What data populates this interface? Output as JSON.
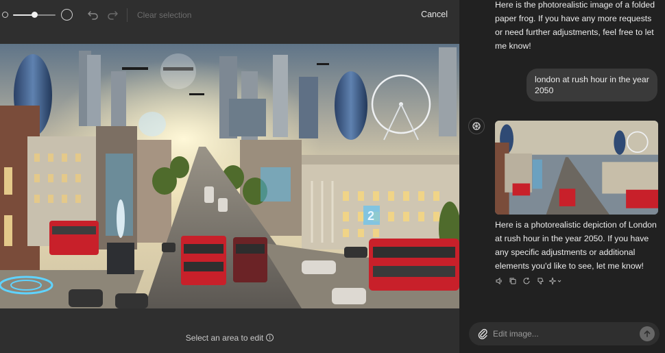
{
  "toolbar": {
    "clear_selection_label": "Clear selection",
    "cancel_label": "Cancel",
    "brush_size_percent": 50,
    "undo_icon": "undo-icon",
    "redo_icon": "redo-icon"
  },
  "editor": {
    "hint": "Select an area to edit",
    "hint_icon": "info-icon",
    "image_subject": "london-2050-rush-hour",
    "image_sign_number": "2"
  },
  "chat": {
    "assistant_prev_message": "Here is the photorealistic image of a folded paper frog. If you have any more requests or need further adjustments, feel free to let me know!",
    "user_message": "london at rush hour in the year 2050",
    "assistant_message": "Here is a photorealistic depiction of London at rush hour in the year 2050. If you have any specific adjustments or additional elements you'd like to see, let me know!",
    "action_icons": [
      "speaker-icon",
      "copy-icon",
      "regenerate-icon",
      "thumbs-down-icon",
      "sparkle-icon"
    ]
  },
  "composer": {
    "placeholder": "Edit image...",
    "attach_icon": "paperclip-icon",
    "send_icon": "arrow-up-icon"
  },
  "colors": {
    "editor_bg": "#2f2f2f",
    "chat_bg": "#212121",
    "bubble_bg": "#3a3a3a",
    "bus_red": "#c8202a",
    "hologram_blue": "#4fc3ff"
  }
}
